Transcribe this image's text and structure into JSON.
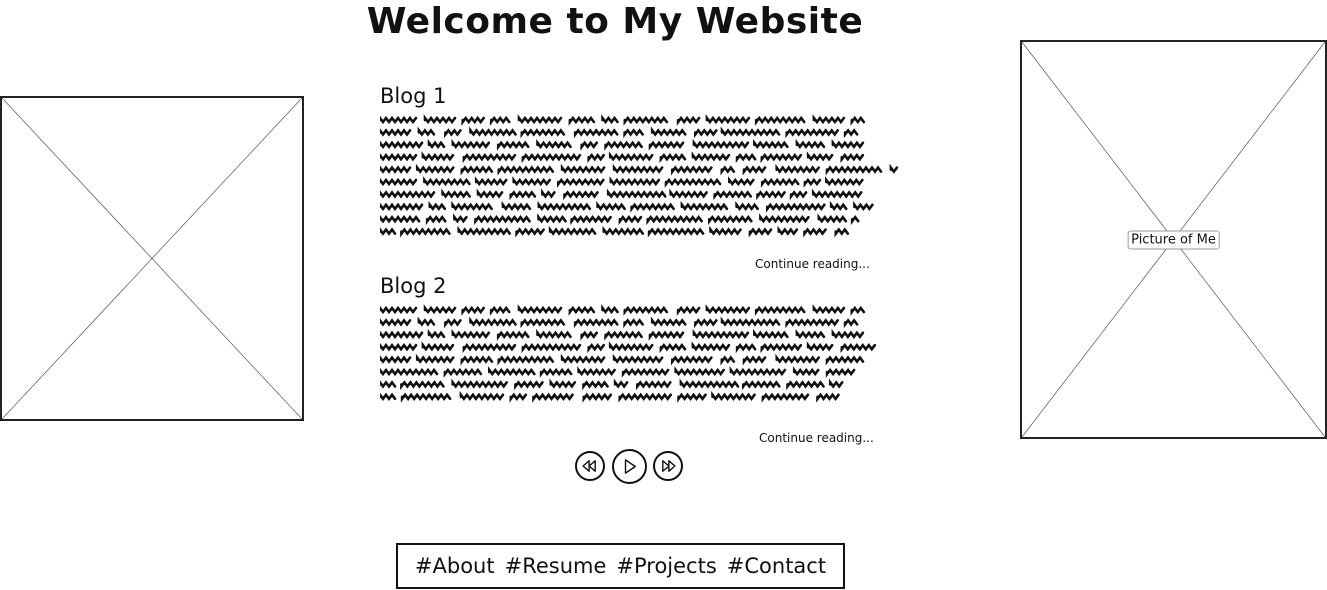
{
  "page": {
    "title": "Welcome to My Website"
  },
  "right_image": {
    "label": "Picture of Me"
  },
  "blogs": [
    {
      "title": "Blog 1",
      "continue_label": "Continue reading..."
    },
    {
      "title": "Blog 2",
      "continue_label": "Continue reading..."
    }
  ],
  "media_controls": {
    "rewind_icon": "rewind-icon",
    "play_icon": "play-icon",
    "fast_forward_icon": "fast-forward-icon"
  },
  "nav": {
    "about": "#About",
    "resume": "#Resume",
    "projects": "#Projects",
    "contact": "#Contact"
  },
  "colors": {
    "ink": "#111111",
    "placeholder_line": "#555555"
  }
}
